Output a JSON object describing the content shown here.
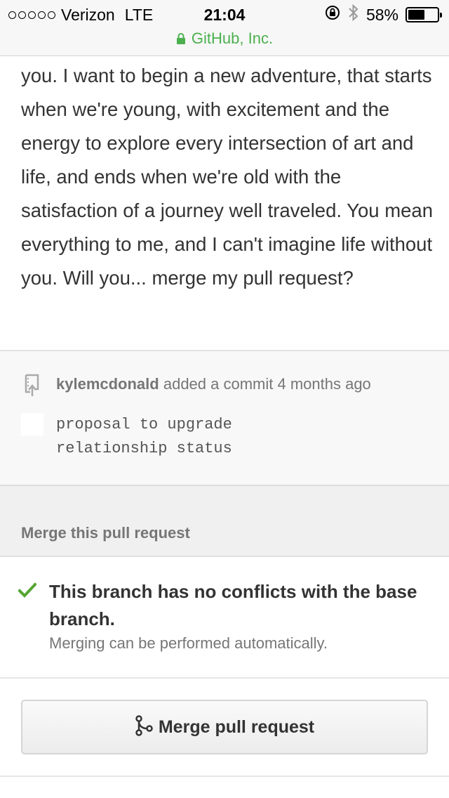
{
  "status_bar": {
    "carrier": "Verizon",
    "network": "LTE",
    "time": "21:04",
    "battery_percent": "58%",
    "battery_level": 0.58
  },
  "url_bar": {
    "site": "GitHub, Inc.",
    "color": "#4cb04f"
  },
  "description": {
    "text": "you. I want to begin a new adventure, that starts when we're young, with excitement and the energy to explore every intersection of art and life, and ends when we're old with the satisfaction of a journey well traveled. You mean everything to me, and I can't imagine life without you. Will you... merge my pull request?"
  },
  "commit": {
    "author": "kylemcdonald",
    "action": "added a commit 4 months ago",
    "message_line1": "proposal to upgrade",
    "message_line2": "relationship status"
  },
  "merge": {
    "header": "Merge this pull request",
    "status_title": "This branch has no conflicts with the base branch.",
    "status_subtitle": "Merging can be performed automatically.",
    "button_label": "Merge pull request",
    "check_color": "#55a532"
  },
  "icons": {
    "lock": "lock-icon",
    "commit": "repo-push-icon",
    "check": "check-icon",
    "merge": "git-merge-icon",
    "bluetooth": "bluetooth-icon",
    "orientation_lock": "orientation-lock-icon"
  }
}
